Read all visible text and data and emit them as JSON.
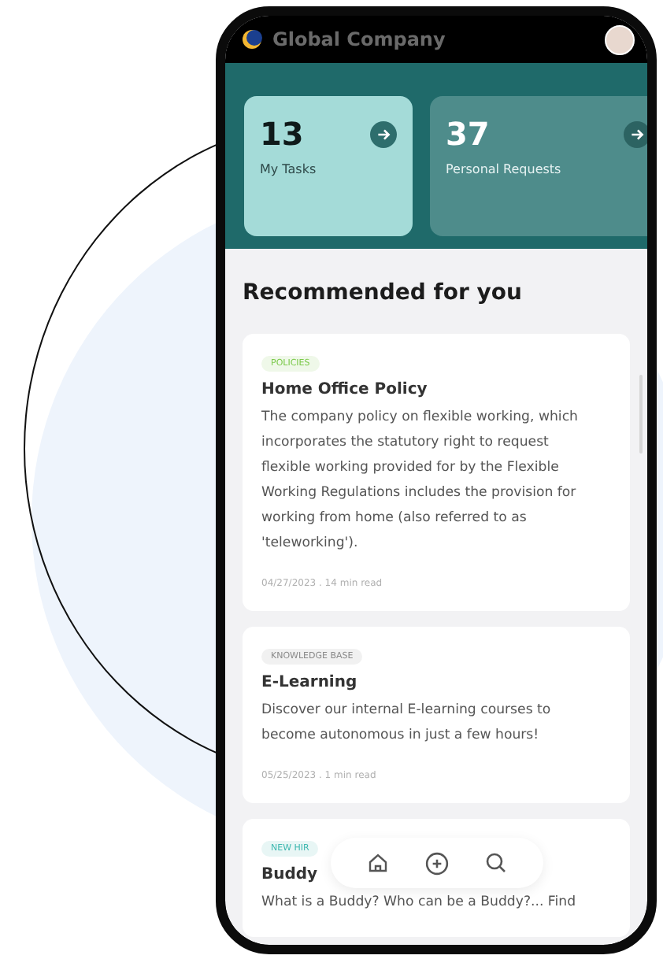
{
  "header": {
    "company_name": "Global Company"
  },
  "stats": [
    {
      "count": "13",
      "label": "My Tasks",
      "selected": true
    },
    {
      "count": "37",
      "label": "Personal Requests",
      "selected": false
    }
  ],
  "section_title": "Recommended for you",
  "articles": [
    {
      "tag": "POLICIES",
      "color": "#7bc94a",
      "title": "Home Office Policy",
      "body": "The company policy on flexible working, which incorporates the statutory right to request flexible working provided for by the Flexible Working Regulations includes the provision for working from home (also referred to as 'teleworking').",
      "meta": "04/27/2023 . 14 min read"
    },
    {
      "tag": "KNOWLEDGE BASE",
      "color": "#8a8a8a",
      "title": "E-Learning",
      "body": "Discover our internal E-learning courses to become autonomous in just a few hours!",
      "meta": "05/25/2023 . 1 min read"
    },
    {
      "tag": "NEW HIR",
      "color": "#3fb8b0",
      "title": "Buddy",
      "body": "What is a Buddy? Who can be a Buddy?... Find"
    }
  ]
}
